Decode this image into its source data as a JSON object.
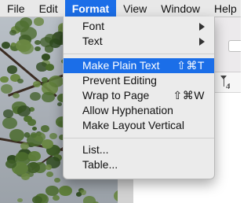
{
  "menubar": {
    "items": [
      "File",
      "Edit",
      "Format",
      "View",
      "Window",
      "Help"
    ],
    "active": "Format"
  },
  "format_menu": {
    "group1": [
      {
        "label": "Font",
        "submenu": true
      },
      {
        "label": "Text",
        "submenu": true
      }
    ],
    "group2": [
      {
        "label": "Make Plain Text",
        "shortcut": "⇧⌘T",
        "highlighted": true
      },
      {
        "label": "Prevent Editing",
        "shortcut": ""
      },
      {
        "label": "Wrap to Page",
        "shortcut": "⇧⌘W"
      },
      {
        "label": "Allow Hyphenation",
        "shortcut": ""
      },
      {
        "label": "Make Layout Vertical",
        "shortcut": ""
      }
    ],
    "group3": [
      {
        "label": "List..."
      },
      {
        "label": "Table..."
      }
    ]
  },
  "document": {
    "ruler_number": "4"
  },
  "colors": {
    "accent": "#1b6ee8",
    "menu_bg": "#ebebeb",
    "menubar_bg": "#e8e8e8"
  }
}
